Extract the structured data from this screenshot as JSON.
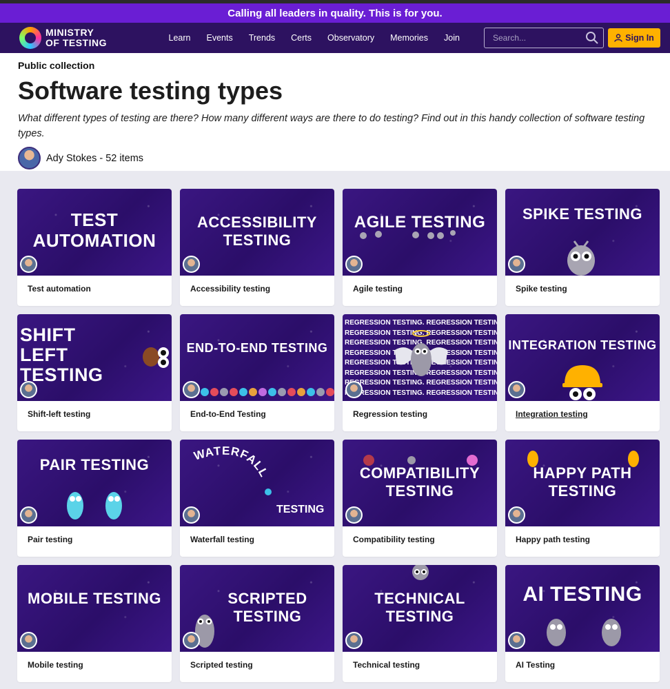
{
  "promo": "Calling all leaders in quality. This is for you.",
  "brand": {
    "line1": "MINISTRY",
    "line2": "OF TESTING"
  },
  "nav": [
    "Learn",
    "Events",
    "Trends",
    "Certs",
    "Observatory",
    "Memories",
    "Join"
  ],
  "search": {
    "placeholder": "Search..."
  },
  "signin": "Sign In",
  "collection": {
    "kicker": "Public collection",
    "title": "Software testing types",
    "description": "What different types of testing are there? How many different ways are there to do testing? Find out in this handy collection of software testing types.",
    "author_line": "Ady Stokes - 52 items"
  },
  "cards": [
    {
      "image_text": "TEST AUTOMATION",
      "caption": "Test automation"
    },
    {
      "image_text": "ACCESSIBILITY TESTING",
      "caption": "Accessibility testing"
    },
    {
      "image_text": "AGILE TESTING",
      "caption": "Agile testing"
    },
    {
      "image_text": "SPIKE TESTING",
      "caption": "Spike testing"
    },
    {
      "image_text": "SHIFT LEFT TESTING",
      "caption": "Shift-left testing"
    },
    {
      "image_text": "END-TO-END TESTING",
      "caption": "End-to-End Testing"
    },
    {
      "image_text": "REGRESSION TESTING. REGRESSION TESTING",
      "caption": "Regression testing"
    },
    {
      "image_text": "INTEGRATION TESTING",
      "caption": "Integration testing"
    },
    {
      "image_text": "PAIR TESTING",
      "caption": "Pair testing"
    },
    {
      "image_text": "WATERFALL TESTING",
      "caption": "Waterfall testing"
    },
    {
      "image_text": "COMPATIBILITY TESTING",
      "caption": "Compatibility testing"
    },
    {
      "image_text": "HAPPY PATH TESTING",
      "caption": "Happy path testing"
    },
    {
      "image_text": "MOBILE TESTING",
      "caption": "Mobile testing"
    },
    {
      "image_text": "SCRIPTED TESTING",
      "caption": "Scripted testing"
    },
    {
      "image_text": "TECHNICAL TESTING",
      "caption": "Technical testing"
    },
    {
      "image_text": "AI TESTING",
      "caption": "AI Testing"
    }
  ],
  "colors": {
    "promo": "#6a1ed4",
    "nav": "#2d1260",
    "signin": "#ffb100",
    "card_bg": "#2b0e69"
  }
}
